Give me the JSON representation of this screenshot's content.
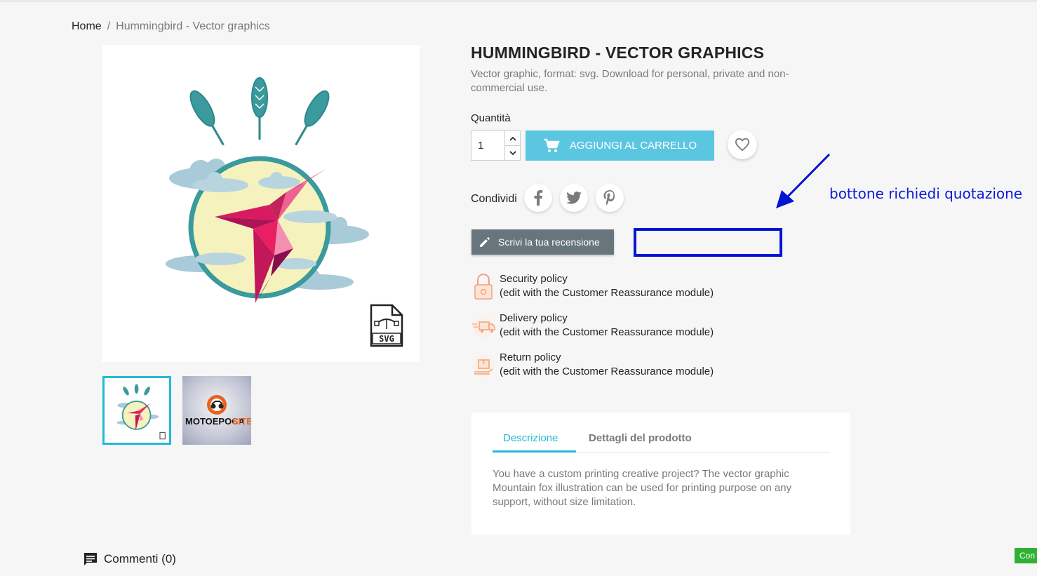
{
  "breadcrumb": {
    "home": "Home",
    "separator": "/",
    "current": "Hummingbird - Vector graphics"
  },
  "product": {
    "title": "HUMMINGBIRD - VECTOR GRAPHICS",
    "short_description": "Vector graphic, format: svg. Download for personal, private and non-commercial use.",
    "svg_badge_text": "SVG",
    "thumbnail_2_brand_left": "MOTOEPOCA",
    "thumbnail_2_brand_right": "SITE"
  },
  "quantity": {
    "label": "Quantità",
    "value": "1"
  },
  "actions": {
    "add_to_cart": "Aggiungi al carrello",
    "write_review": "Scrivi la tua recensione"
  },
  "share": {
    "label": "Condividi",
    "networks": [
      "facebook-icon",
      "twitter-icon",
      "pinterest-icon"
    ]
  },
  "annotation": {
    "text": "bottone richiedi quotazione",
    "color": "#0015d6"
  },
  "reassurance": [
    {
      "title": "Security policy",
      "subtitle": "(edit with the Customer Reassurance module)",
      "icon": "padlock-icon"
    },
    {
      "title": "Delivery policy",
      "subtitle": "(edit with the Customer Reassurance module)",
      "icon": "delivery-truck-icon"
    },
    {
      "title": "Return policy",
      "subtitle": "(edit with the Customer Reassurance module)",
      "icon": "return-box-icon"
    }
  ],
  "tabs": {
    "items": [
      {
        "label": "Descrizione",
        "active": true
      },
      {
        "label": "Dettagli del prodotto",
        "active": false
      }
    ],
    "description_text": "You have a custom printing creative project? The vector graphic Mountain fox illustration can be used for printing purpose on any support, without size limitation."
  },
  "comments": {
    "label": "Commenti (0)"
  },
  "cookie_button": {
    "label": "Con"
  },
  "colors": {
    "accent": "#24b9d7",
    "cart_button": "#5bc6e0",
    "review_button": "#68757c",
    "annotation_blue": "#0015d6"
  }
}
